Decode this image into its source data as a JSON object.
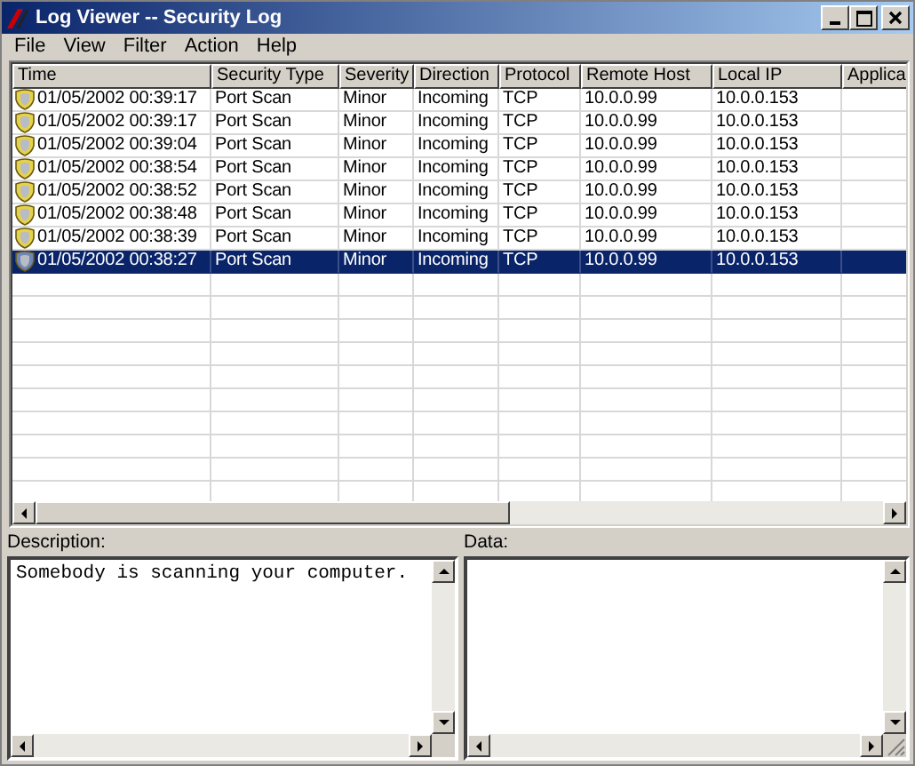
{
  "window": {
    "title": "Log Viewer -- Security Log"
  },
  "menu": [
    "File",
    "View",
    "Filter",
    "Action",
    "Help"
  ],
  "table": {
    "columns": [
      "Time",
      "Security Type",
      "Severity",
      "Direction",
      "Protocol",
      "Remote Host",
      "Local IP",
      "Applica"
    ],
    "rows": [
      {
        "cells": [
          "01/05/2002 00:39:17",
          "Port Scan",
          "Minor",
          "Incoming",
          "TCP",
          "10.0.0.99",
          "10.0.0.153",
          ""
        ],
        "selected": false
      },
      {
        "cells": [
          "01/05/2002 00:39:17",
          "Port Scan",
          "Minor",
          "Incoming",
          "TCP",
          "10.0.0.99",
          "10.0.0.153",
          ""
        ],
        "selected": false
      },
      {
        "cells": [
          "01/05/2002 00:39:04",
          "Port Scan",
          "Minor",
          "Incoming",
          "TCP",
          "10.0.0.99",
          "10.0.0.153",
          ""
        ],
        "selected": false
      },
      {
        "cells": [
          "01/05/2002 00:38:54",
          "Port Scan",
          "Minor",
          "Incoming",
          "TCP",
          "10.0.0.99",
          "10.0.0.153",
          ""
        ],
        "selected": false
      },
      {
        "cells": [
          "01/05/2002 00:38:52",
          "Port Scan",
          "Minor",
          "Incoming",
          "TCP",
          "10.0.0.99",
          "10.0.0.153",
          ""
        ],
        "selected": false
      },
      {
        "cells": [
          "01/05/2002 00:38:48",
          "Port Scan",
          "Minor",
          "Incoming",
          "TCP",
          "10.0.0.99",
          "10.0.0.153",
          ""
        ],
        "selected": false
      },
      {
        "cells": [
          "01/05/2002 00:38:39",
          "Port Scan",
          "Minor",
          "Incoming",
          "TCP",
          "10.0.0.99",
          "10.0.0.153",
          ""
        ],
        "selected": false
      },
      {
        "cells": [
          "01/05/2002 00:38:27",
          "Port Scan",
          "Minor",
          "Incoming",
          "TCP",
          "10.0.0.99",
          "10.0.0.153",
          ""
        ],
        "selected": true
      }
    ]
  },
  "description": {
    "label": "Description:",
    "value": "Somebody is scanning your computer."
  },
  "data": {
    "label": "Data:"
  }
}
